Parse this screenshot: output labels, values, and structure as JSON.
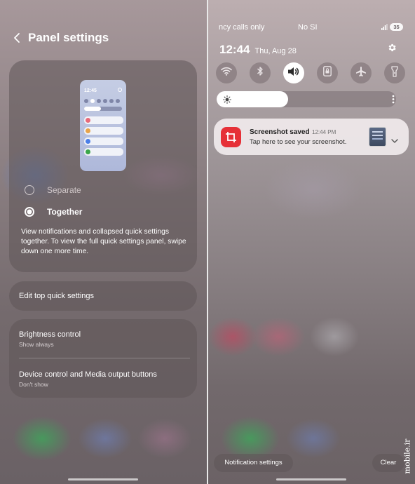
{
  "left_panel": {
    "title": "Panel settings",
    "preview": {
      "time": "12:45",
      "notification_colors": [
        "#e86a7a",
        "#e8a34a",
        "#4a7ee8",
        "#3aa64a"
      ]
    },
    "options": [
      {
        "label": "Separate",
        "selected": false
      },
      {
        "label": "Together",
        "selected": true
      }
    ],
    "description": "View notifications and collapsed quick settings together. To view the full quick settings panel, swipe down one more time.",
    "edit_label": "Edit top quick settings",
    "brightness_control": {
      "title": "Brightness control",
      "subtitle": "Show always"
    },
    "device_control": {
      "title": "Device control and Media output buttons",
      "subtitle": "Don't show"
    }
  },
  "right_panel": {
    "status": {
      "carrier": "ncy calls only",
      "sim": "No SI",
      "battery": "35"
    },
    "clock": "12:44",
    "date": "Thu, Aug 28",
    "quick_settings": [
      {
        "icon": "wifi-icon",
        "active": false
      },
      {
        "icon": "bluetooth-icon",
        "active": false
      },
      {
        "icon": "sound-icon",
        "active": true
      },
      {
        "icon": "screen-lock-icon",
        "active": false
      },
      {
        "icon": "airplane-icon",
        "active": false
      },
      {
        "icon": "flashlight-icon",
        "active": false
      }
    ],
    "brightness_level": 0.4,
    "notification": {
      "title": "Screenshot saved",
      "time": "12:44 PM",
      "text": "Tap here to see your screenshot."
    },
    "notification_settings_label": "Notification settings",
    "clear_label": "Clear",
    "watermark": "mobile.ir"
  },
  "colors": {
    "accent_white": "#ffffff",
    "notif_icon_red": "#e63037"
  }
}
